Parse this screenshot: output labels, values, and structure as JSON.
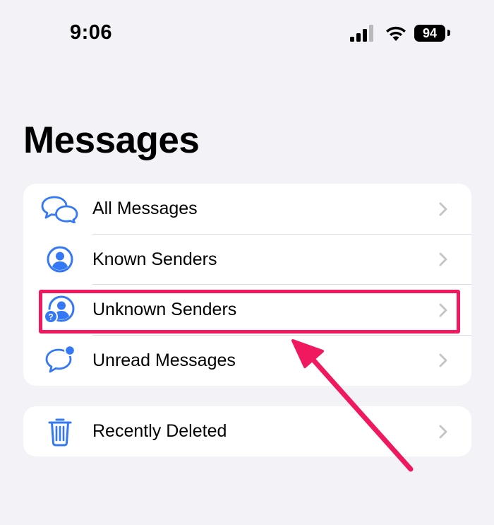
{
  "status_bar": {
    "time": "9:06",
    "battery_level": "94",
    "signal_icon": "cellular-signal-icon",
    "wifi_icon": "wifi-icon"
  },
  "page": {
    "title": "Messages"
  },
  "filters": [
    {
      "label": "All Messages",
      "icon": "speech-bubbles-icon"
    },
    {
      "label": "Known Senders",
      "icon": "person-circle-icon"
    },
    {
      "label": "Unknown Senders",
      "icon": "person-question-icon"
    },
    {
      "label": "Unread Messages",
      "icon": "unread-bubble-icon"
    }
  ],
  "deleted": {
    "label": "Recently Deleted",
    "icon": "trash-icon"
  },
  "colors": {
    "accent": "#3478f6",
    "highlight": "#f0195f",
    "background": "#f2f2f7"
  }
}
